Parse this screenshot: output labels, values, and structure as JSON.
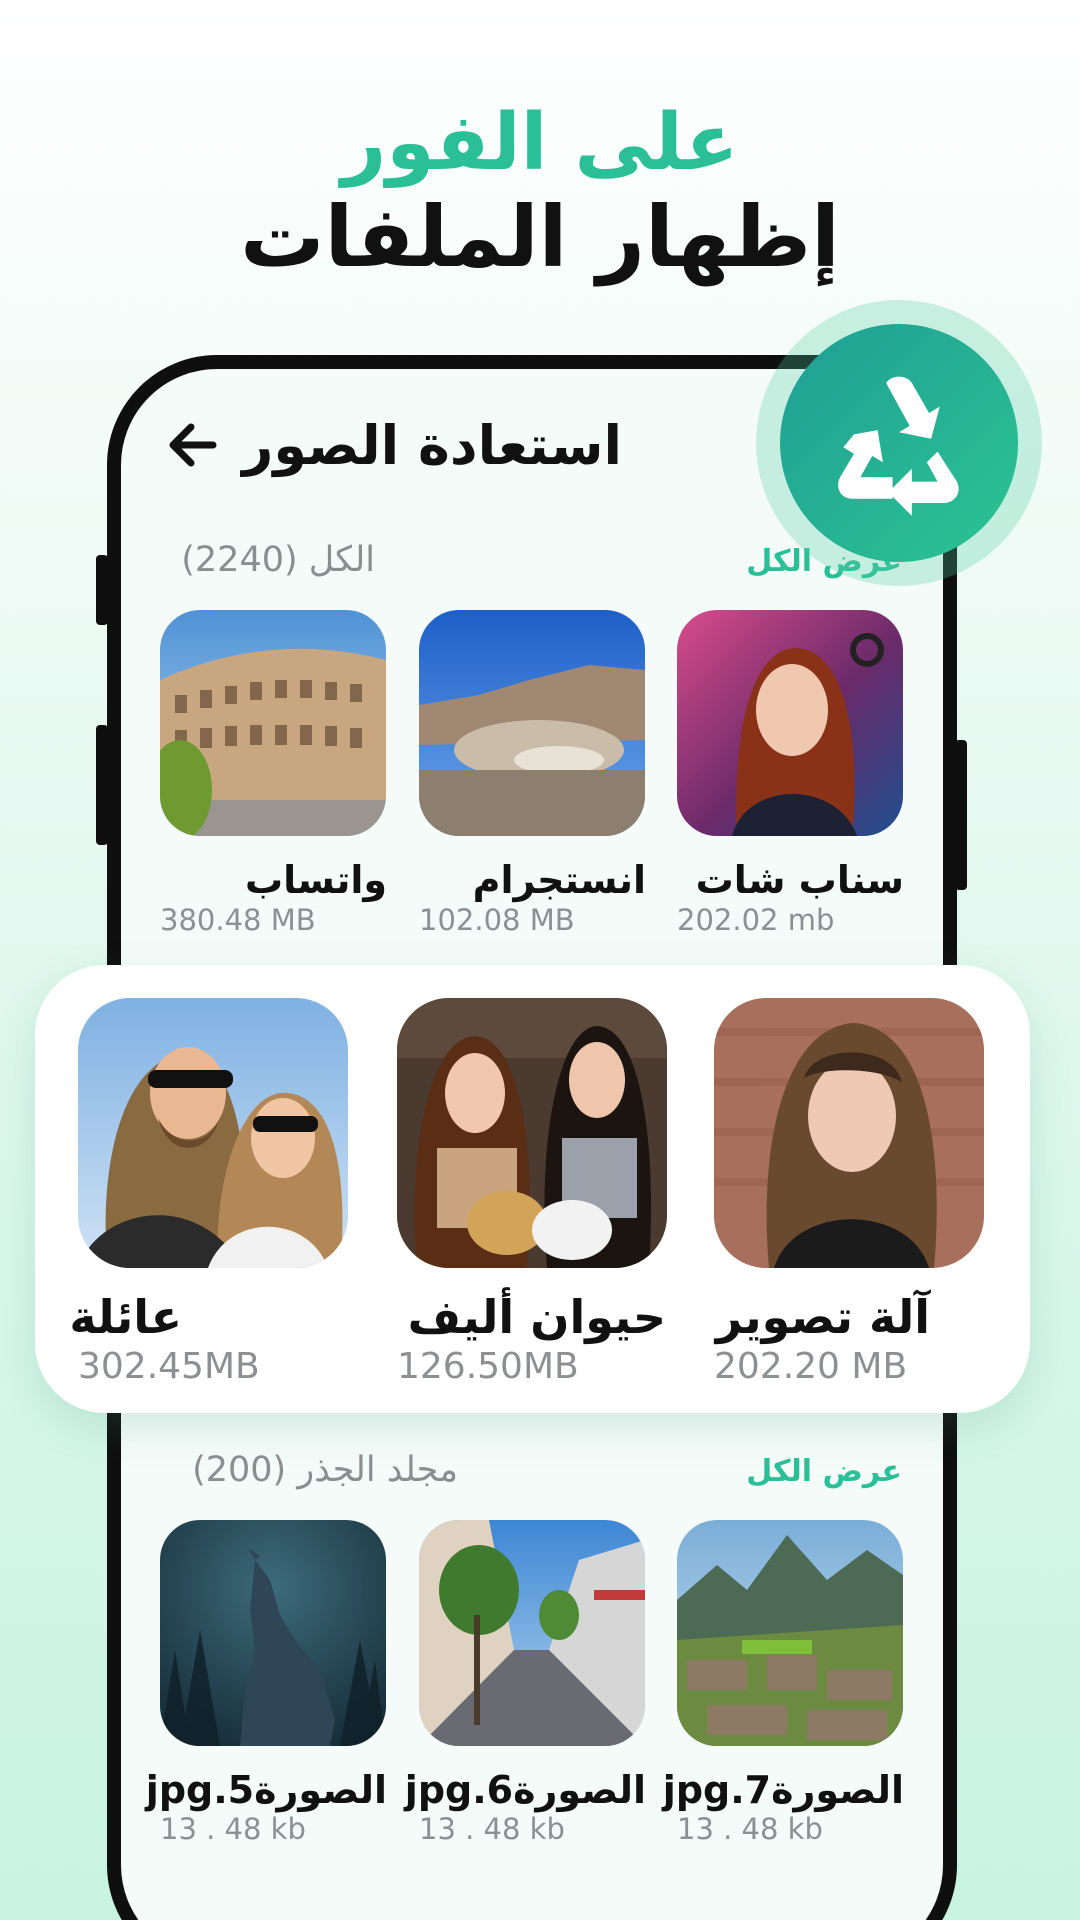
{
  "headline": {
    "accent": "على الفور",
    "main": "إظهار الملفات"
  },
  "app": {
    "title": "استعادة الصور"
  },
  "section_all": {
    "title": "الكل (2240)",
    "view_all": "عرض الكل"
  },
  "section_root": {
    "title": "مجلد الجذر (200)",
    "view_all": "عرض الكل"
  },
  "apps": [
    {
      "label": "سناب شات",
      "size": "202.02 mb"
    },
    {
      "label": "انستجرام",
      "size": "102.08 MB"
    },
    {
      "label": "واتساب",
      "size": "380.48 MB"
    }
  ],
  "categories": [
    {
      "label": "آلة تصوير",
      "size": "202.20 MB"
    },
    {
      "label": "حيوان أليف",
      "size": "126.50MB"
    },
    {
      "label": "عائلة",
      "size": "302.45MB"
    }
  ],
  "files": [
    {
      "label": "الصورة7.jpg",
      "size": "13 . 48 kb"
    },
    {
      "label": "الصورة6.jpg",
      "size": "13 . 48 kb"
    },
    {
      "label": "الصورة5.jpg",
      "size": "13 . 48 kb"
    }
  ],
  "icons": {
    "back": "back-arrow-icon",
    "recycle": "recycle-icon"
  },
  "colors": {
    "accent": "#2bbf98",
    "text": "#111111",
    "muted": "#8d9092",
    "badge_start": "#1f9e94",
    "badge_end": "#2cc493"
  }
}
